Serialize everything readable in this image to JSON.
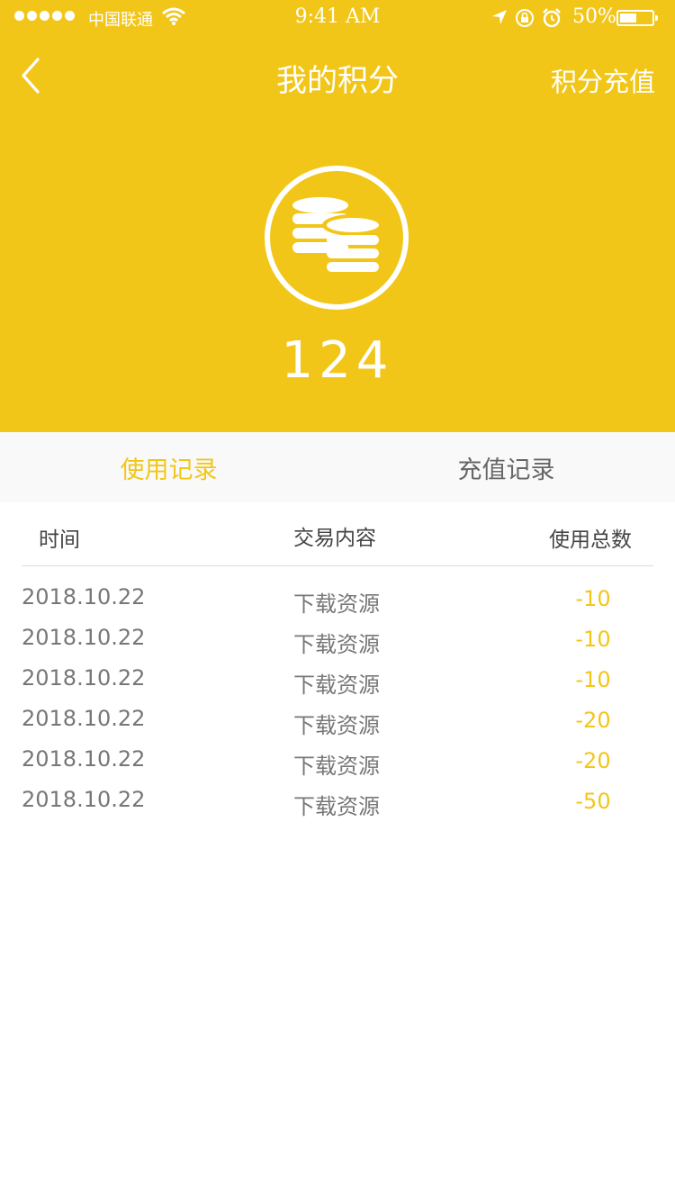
{
  "status_bar": {
    "carrier": "中国联通",
    "time": "9:41 AM",
    "battery": "50%"
  },
  "nav": {
    "title": "我的积分",
    "right_action": "积分充值"
  },
  "points": {
    "value": "124"
  },
  "tabs": [
    {
      "label": "使用记录",
      "active": true
    },
    {
      "label": "充值记录",
      "active": false
    }
  ],
  "table": {
    "headers": [
      "时间",
      "交易内容",
      "使用总数"
    ],
    "rows": [
      {
        "date": "2018.10.22",
        "desc": "下载资源",
        "amount": "-10"
      },
      {
        "date": "2018.10.22",
        "desc": "下载资源",
        "amount": "-10"
      },
      {
        "date": "2018.10.22",
        "desc": "下载资源",
        "amount": "-10"
      },
      {
        "date": "2018.10.22",
        "desc": "下载资源",
        "amount": "-20"
      },
      {
        "date": "2018.10.22",
        "desc": "下载资源",
        "amount": "-20"
      },
      {
        "date": "2018.10.22",
        "desc": "下载资源",
        "amount": "-50"
      }
    ]
  },
  "icons": {
    "back": "chevron-left-icon",
    "coins": "coin-stack-icon"
  },
  "colors": {
    "accent": "#f2c619",
    "amount": "#f2c619"
  }
}
